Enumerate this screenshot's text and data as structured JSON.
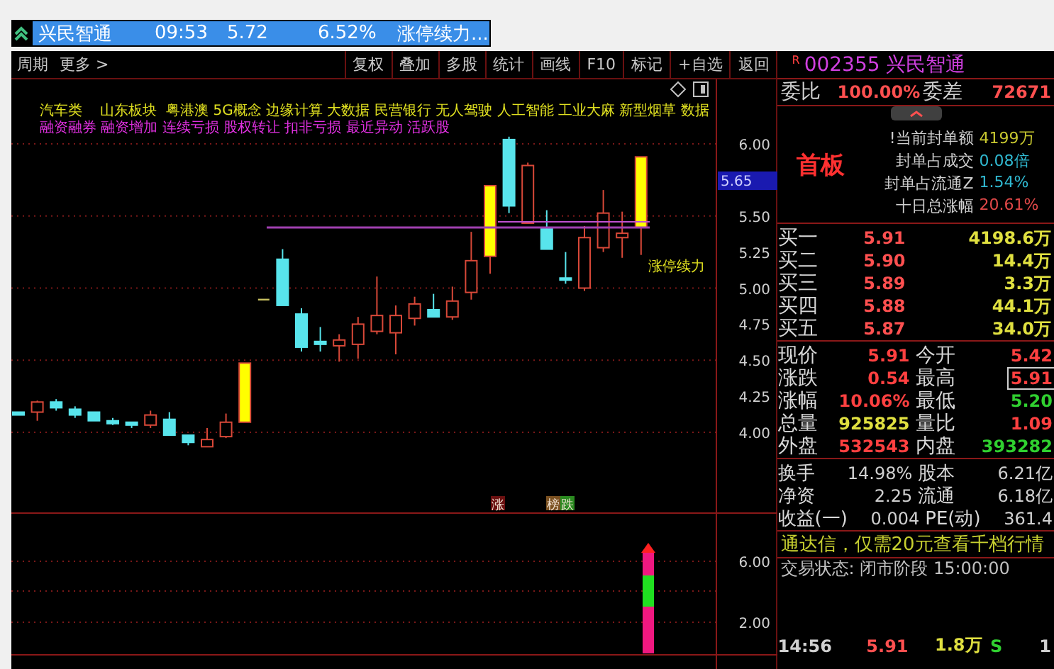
{
  "quote_bar": {
    "name": "兴民智通",
    "time": "09:53",
    "price": "5.72",
    "change_pct": "6.52%",
    "signal": "涨停续力..."
  },
  "toolbar": {
    "left": [
      "周期",
      "更多 >"
    ],
    "buttons": [
      "复权",
      "叠加",
      "多股",
      "统计",
      "画线",
      "F10",
      "标记",
      "+自选",
      "返回"
    ]
  },
  "chart": {
    "concepts": "汽车类    山东板块  粤港澳 5G概念 边缘计算 大数据 民营银行 无人驾驶 人工智能 工业大麻 新型烟草 数据",
    "tags": "融资融券 融资增加 连续亏损 股权转让 扣非亏损 最近异动 活跃股",
    "price_axis": [
      "6.00",
      "5.50",
      "5.25",
      "5.00",
      "4.75",
      "4.50",
      "4.25",
      "4.00"
    ],
    "current_price_label": "5.65",
    "annotation": "涨停续力",
    "markers": [
      {
        "text": "涨",
        "color": "#6a1010"
      },
      {
        "text": "榜",
        "color": "#7a5020"
      },
      {
        "text": "跌",
        "color": "#2a8a20"
      }
    ],
    "volume_axis": [
      "6.00",
      "2.00"
    ]
  },
  "quote_panel": {
    "flag": "R",
    "code": "002355",
    "name": "兴民智通",
    "order_ratio": [
      {
        "label": "委比",
        "value": "100.00%"
      },
      {
        "label": "委差",
        "value": "72671"
      }
    ],
    "board": {
      "title": "首板",
      "lines": [
        {
          "label": "!当前封单额",
          "value": "4199万",
          "color": "#c8c830"
        },
        {
          "label": "封单占成交",
          "value": "0.08倍",
          "color": "#30b8d0"
        },
        {
          "label": "封单占流通Z",
          "value": "1.54%",
          "color": "#30b8d0"
        },
        {
          "label": "十日总涨幅",
          "value": "20.61%",
          "color": "#e04848"
        }
      ]
    },
    "bids": [
      {
        "label": "买一",
        "price": "5.91",
        "volume": "4198.6万"
      },
      {
        "label": "买二",
        "price": "5.90",
        "volume": "14.4万"
      },
      {
        "label": "买三",
        "price": "5.89",
        "volume": "3.3万"
      },
      {
        "label": "买四",
        "price": "5.88",
        "volume": "44.1万"
      },
      {
        "label": "买五",
        "price": "5.87",
        "volume": "34.0万"
      }
    ],
    "stats": [
      {
        "label": "现价",
        "value": "5.91",
        "color": "#ff4040",
        "boxed": false
      },
      {
        "label": "今开",
        "value": "5.42",
        "color": "#ff4040",
        "boxed": false
      },
      {
        "label": "涨跌",
        "value": "0.54",
        "color": "#ff4040",
        "boxed": false
      },
      {
        "label": "最高",
        "value": "5.91",
        "color": "#ff4040",
        "boxed": true
      },
      {
        "label": "涨幅",
        "value": "10.06%",
        "color": "#ff4040",
        "boxed": false
      },
      {
        "label": "最低",
        "value": "5.20",
        "color": "#30d030",
        "boxed": false
      },
      {
        "label": "总量",
        "value": "925825",
        "color": "#e0e040",
        "boxed": false
      },
      {
        "label": "量比",
        "value": "1.09",
        "color": "#ff4040",
        "boxed": false
      },
      {
        "label": "外盘",
        "value": "532543",
        "color": "#ff4040",
        "boxed": false
      },
      {
        "label": "内盘",
        "value": "393282",
        "color": "#30d030",
        "boxed": false
      }
    ],
    "finance": [
      {
        "label": "换手",
        "value": "14.98%"
      },
      {
        "label": "股本",
        "value": "6.21亿"
      },
      {
        "label": "净资",
        "value": "2.25"
      },
      {
        "label": "流通",
        "value": "6.18亿"
      },
      {
        "label": "收益(一)",
        "value": "0.004"
      },
      {
        "label": "PE(动)",
        "value": "361.4"
      }
    ],
    "banner": "通达信，仅需20元查看千档行情",
    "status": "交易状态: 闭市阶段 15:00:00",
    "trades": [
      {
        "time": "14:56",
        "price": "5.91",
        "volume": "1.8万",
        "side": "S",
        "count": "1"
      }
    ]
  }
}
